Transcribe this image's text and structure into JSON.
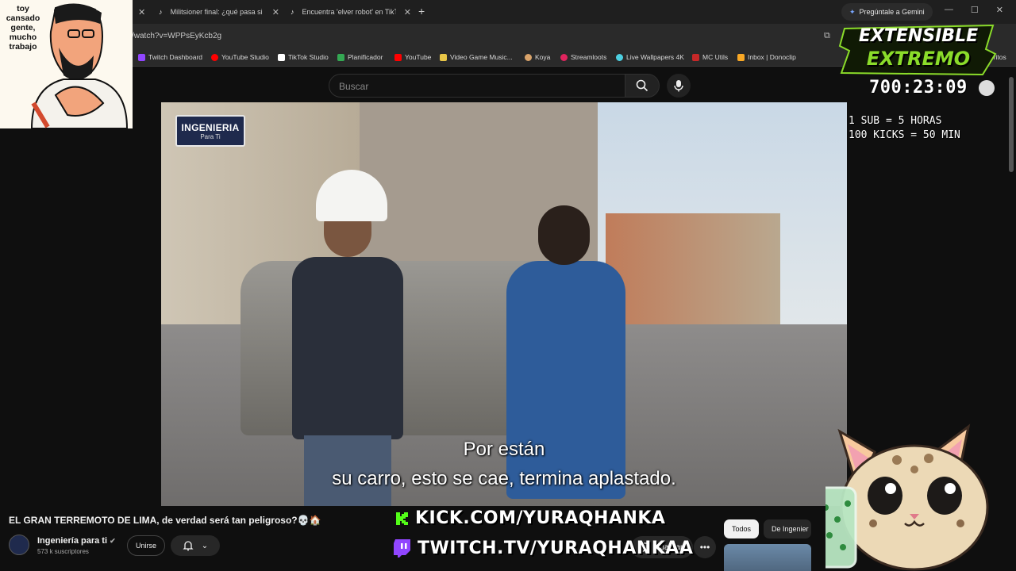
{
  "browser": {
    "tabs": [
      {
        "label": "Militsioner final: ¿qué pasa si u"
      },
      {
        "label": "Encuentra 'elver robot' en TikTo"
      }
    ],
    "gemini_label": "Pregúntale a Gemini",
    "url": "/watch?v=WPPsEyKcb2g",
    "bookmarks": [
      {
        "label": "Twitch Dashboard",
        "color": "#9146ff"
      },
      {
        "label": "YouTube Studio",
        "color": "#ff0000"
      },
      {
        "label": "TikTok Studio",
        "color": "#ffffff"
      },
      {
        "label": "Planificador",
        "color": "#34a853"
      },
      {
        "label": "YouTube",
        "color": "#ff0000"
      },
      {
        "label": "Video Game Music...",
        "color": "#e8c547"
      },
      {
        "label": "Koya",
        "color": "#d9a36a"
      },
      {
        "label": "Streamloots",
        "color": "#e0245e"
      },
      {
        "label": "Live Wallpapers 4K",
        "color": "#4dd0e1"
      },
      {
        "label": "MC Utils",
        "color": "#c62828"
      },
      {
        "label": "Inbox | Donoclip",
        "color": "#f9a825"
      }
    ],
    "bookmarks_more": "avoritos"
  },
  "youtube": {
    "search_placeholder": "Buscar",
    "video": {
      "channel_logo_line1": "INGENIERIA",
      "channel_logo_line2": "Para Ti",
      "subtitle_line1": "Por están",
      "subtitle_line2": "su carro, esto se cae, termina aplastado."
    },
    "title": "EL GRAN TERREMOTO DE LIMA, de verdad será tan peligroso?💀🏠",
    "channel_name": "Ingeniería para ti",
    "channel_subs": "573 k suscriptores",
    "join_label": "Unirse",
    "save_label": "Guardar",
    "chips": [
      {
        "label": "Todos"
      },
      {
        "label": "De Ingenier"
      }
    ]
  },
  "stream_overlay": {
    "meme_text": "toy cansado gente, mucho trabajo",
    "brand_line1": "EXTENSIBLE",
    "brand_line2": "EXTREMO",
    "timer": "700:23:09",
    "rule1": "1 SUB = 5 HORAS",
    "rule2": "100 KICKS = 50 MIN",
    "kick_url": "KICK.COM/YURAQHANKA",
    "twitch_url": "TWITCH.TV/YURAQHANKAA",
    "colors": {
      "brand_green": "#8bdc2a",
      "kick_green": "#53fc18",
      "twitch_purple": "#9146ff"
    }
  }
}
